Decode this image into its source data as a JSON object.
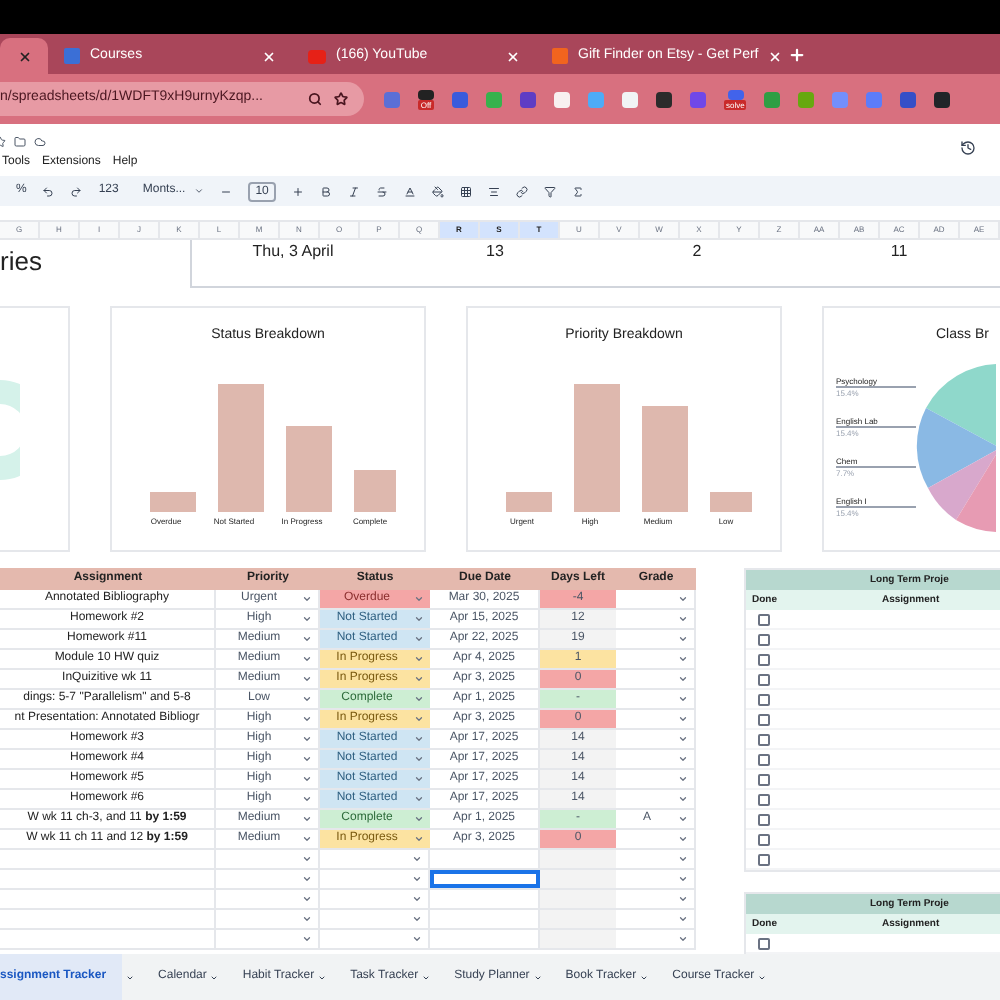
{
  "browser": {
    "tabs": [
      {
        "selected": true
      },
      {
        "title": "Courses",
        "selected": false
      },
      {
        "title": "(166) YouTube",
        "selected": false
      },
      {
        "title": "Gift Finder on Etsy - Get Perf",
        "selected": false
      }
    ],
    "url": "n/spreadsheets/d/1WDFT9xH9urnyKzqp...",
    "extensions": [
      {
        "color": "#5b6fd6"
      },
      {
        "color": "#222222",
        "badge": "Off"
      },
      {
        "color": "#3b5bdb"
      },
      {
        "color": "#37b24d"
      },
      {
        "color": "#5f3dc4"
      },
      {
        "color": "#f8f0f0"
      },
      {
        "color": "#4dabf7"
      },
      {
        "color": "#f1f3f5"
      },
      {
        "color": "#2b2b2b"
      },
      {
        "color": "#7048e8"
      },
      {
        "color": "#4263eb",
        "badge": "solve"
      },
      {
        "color": "#2f9e44"
      },
      {
        "color": "#66a80f"
      },
      {
        "color": "#748ffc"
      },
      {
        "color": "#5c7cfa"
      },
      {
        "color": "#364fc7"
      },
      {
        "color": "#212529"
      }
    ]
  },
  "menu": [
    "Tools",
    "Extensions",
    "Help"
  ],
  "toolbar": {
    "items": [
      "%",
      "123"
    ],
    "font": "Monts...",
    "font_size": "10"
  },
  "columns": [
    {
      "letter": "G",
      "selected": false
    },
    {
      "letter": "H",
      "selected": false
    },
    {
      "letter": "I",
      "selected": false
    },
    {
      "letter": "J",
      "selected": false
    },
    {
      "letter": "K",
      "selected": false
    },
    {
      "letter": "L",
      "selected": false
    },
    {
      "letter": "M",
      "selected": false
    },
    {
      "letter": "N",
      "selected": false
    },
    {
      "letter": "O",
      "selected": false
    },
    {
      "letter": "P",
      "selected": false
    },
    {
      "letter": "Q",
      "selected": false
    },
    {
      "letter": "R",
      "selected": true
    },
    {
      "letter": "S",
      "selected": true
    },
    {
      "letter": "T",
      "selected": true
    },
    {
      "letter": "U",
      "selected": false
    },
    {
      "letter": "V",
      "selected": false
    },
    {
      "letter": "W",
      "selected": false
    },
    {
      "letter": "X",
      "selected": false
    },
    {
      "letter": "Y",
      "selected": false
    },
    {
      "letter": "Z",
      "selected": false
    },
    {
      "letter": "AA",
      "selected": false
    },
    {
      "letter": "AB",
      "selected": false
    },
    {
      "letter": "AC",
      "selected": false
    },
    {
      "letter": "AD",
      "selected": false
    },
    {
      "letter": "AE",
      "selected": false
    }
  ],
  "heading": "ries",
  "summary": [
    "Thu, 3 April",
    "13",
    "2",
    "11"
  ],
  "charts": [
    {
      "title": "Status Breakdown",
      "categories": [
        "Overdue",
        "Not Started",
        "In Progress",
        "Complete"
      ]
    },
    {
      "title": "Priority Breakdown",
      "categories": [
        "Urgent",
        "High",
        "Medium",
        "Low"
      ]
    }
  ],
  "class_chart": {
    "title": "Class Br",
    "labels": [
      {
        "name": "Psychology",
        "share": "15.4%"
      },
      {
        "name": "English Lab",
        "share": "15.4%"
      },
      {
        "name": "Chem",
        "share": "7.7%"
      },
      {
        "name": "English I",
        "share": "15.4%"
      }
    ]
  },
  "table": {
    "columns": [
      "Assignment",
      "Priority",
      "Status",
      "Due Date",
      "Days Left",
      "Grade"
    ],
    "rows": [
      {
        "assignment": "Annotated Bibliography",
        "priority": "Urgent",
        "status": {
          "label": "Overdue",
          "kind": "overdue"
        },
        "due": "Mar 30, 2025",
        "days_left": {
          "text": "-4",
          "color": "#f4a6a6"
        }
      },
      {
        "assignment": "Homework #2",
        "priority": "High",
        "status": {
          "label": "Not Started",
          "kind": "not_started"
        },
        "due": "Apr 15, 2025",
        "days_left": {
          "text": "12"
        }
      },
      {
        "assignment": "Homework #11",
        "priority": "Medium",
        "status": {
          "label": "Not Started",
          "kind": "not_started"
        },
        "due": "Apr 22, 2025",
        "days_left": {
          "text": "19"
        }
      },
      {
        "assignment": "Module 10 HW quiz",
        "priority": "Medium",
        "status": {
          "label": "In Progress",
          "kind": "in_progress"
        },
        "due": "Apr 4, 2025",
        "days_left": {
          "text": "1",
          "color": "#fce3a1"
        }
      },
      {
        "assignment": "InQuizitive wk 11",
        "priority": "Medium",
        "status": {
          "label": "In Progress",
          "kind": "in_progress"
        },
        "due": "Apr 3, 2025",
        "days_left": {
          "text": "0",
          "color": "#f4a6a6"
        }
      },
      {
        "assignment": "dings: 5-7 \"Parallelism\" and 5-8",
        "priority": "Low",
        "status": {
          "label": "Complete",
          "kind": "complete"
        },
        "due": "Apr 1, 2025",
        "days_left": {
          "text": "-",
          "color": "#cdeed3"
        }
      },
      {
        "assignment": "nt Presentation: Annotated Bibliogr",
        "priority": "High",
        "status": {
          "label": "In Progress",
          "kind": "in_progress"
        },
        "due": "Apr 3, 2025",
        "days_left": {
          "text": "0",
          "color": "#f4a6a6"
        }
      },
      {
        "assignment": "Homework #3",
        "priority": "High",
        "status": {
          "label": "Not Started",
          "kind": "not_started"
        },
        "due": "Apr 17, 2025",
        "days_left": {
          "text": "14"
        }
      },
      {
        "assignment": "Homework #4",
        "priority": "High",
        "status": {
          "label": "Not Started",
          "kind": "not_started"
        },
        "due": "Apr 17, 2025",
        "days_left": {
          "text": "14"
        }
      },
      {
        "assignment": "Homework #5",
        "priority": "High",
        "status": {
          "label": "Not Started",
          "kind": "not_started"
        },
        "due": "Apr 17, 2025",
        "days_left": {
          "text": "14"
        }
      },
      {
        "assignment": "Homework #6",
        "priority": "High",
        "status": {
          "label": "Not Started",
          "kind": "not_started"
        },
        "due": "Apr 17, 2025",
        "days_left": {
          "text": "14"
        }
      },
      {
        "assignment": "W wk 11 ch-3, and 11 **by 1:59**",
        "priority": "Medium",
        "status": {
          "label": "Complete",
          "kind": "complete"
        },
        "due": "Apr 1, 2025",
        "days_left": {
          "text": "-",
          "color": "#cdeed3"
        },
        "grade": "A"
      },
      {
        "assignment": "W wk 11 ch 11 and 12 **by 1:59**",
        "priority": "Medium",
        "status": {
          "label": "In Progress",
          "kind": "in_progress"
        },
        "due": "Apr 3, 2025",
        "days_left": {
          "text": "0",
          "color": "#f4a6a6"
        }
      }
    ],
    "empty_rows": [
      {
        "selected": false
      },
      {
        "selected": true
      },
      {
        "selected": false
      },
      {
        "selected": false
      },
      {
        "selected": false
      }
    ]
  },
  "projects": [
    {
      "title": "Long Term Proje",
      "columns": [
        "Done",
        "Assignment"
      ],
      "rows": [
        {
          "checked": false
        },
        {
          "checked": false
        },
        {
          "checked": false
        },
        {
          "checked": false
        },
        {
          "checked": false
        },
        {
          "checked": false
        },
        {
          "checked": false
        },
        {
          "checked": false
        },
        {
          "checked": false
        },
        {
          "checked": false
        },
        {
          "checked": false
        },
        {
          "checked": false
        },
        {
          "checked": false
        }
      ]
    },
    {
      "title": "Long Term Proje",
      "columns": [
        "Done",
        "Assignment"
      ],
      "rows": [
        {
          "checked": false
        }
      ]
    }
  ],
  "sheets": [
    {
      "name": "ssignment Tracker",
      "selected": true
    },
    {
      "name": "Calendar",
      "selected": false
    },
    {
      "name": "Habit Tracker",
      "selected": false
    },
    {
      "name": "Task Tracker",
      "selected": false
    },
    {
      "name": "Study Planner",
      "selected": false
    },
    {
      "name": "Book Tracker",
      "selected": false
    },
    {
      "name": "Course Tracker",
      "selected": false
    }
  ]
}
